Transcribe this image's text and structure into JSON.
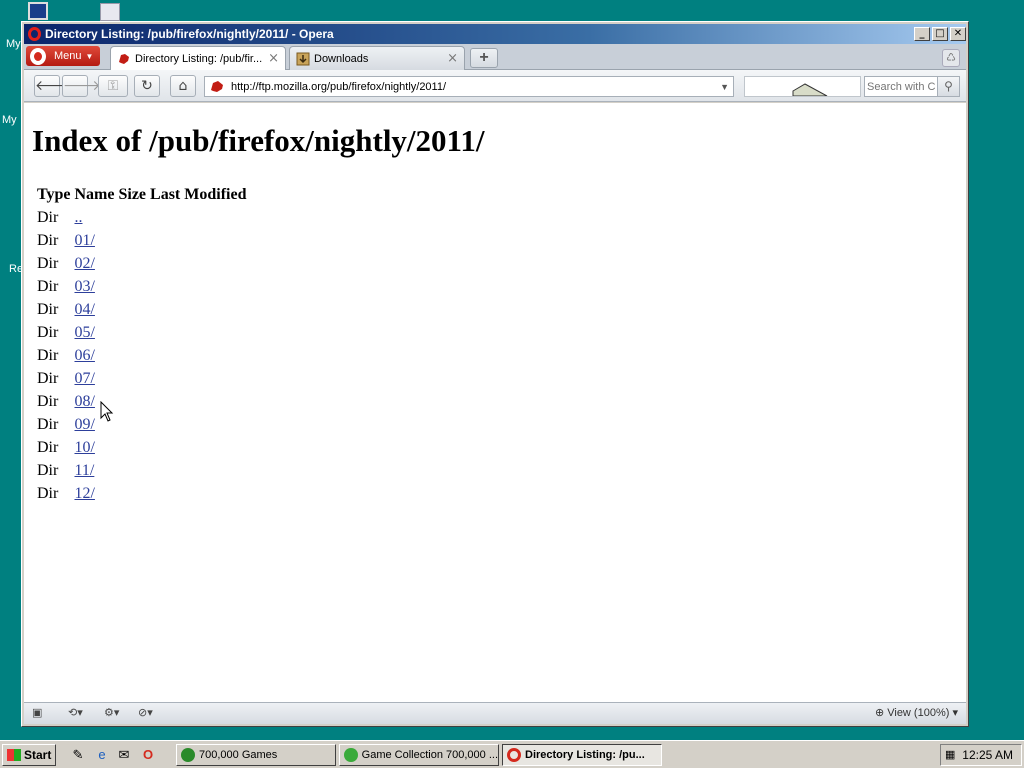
{
  "desktop": {
    "labels": [
      "My",
      "My",
      "Re"
    ]
  },
  "window": {
    "title": "Directory Listing: /pub/firefox/nightly/2011/ - Opera",
    "minimize_glyph": "_",
    "maximize_glyph": "□",
    "close_glyph": "✕"
  },
  "tabbar": {
    "menu_label": "Menu",
    "tabs": [
      {
        "label": "Directory Listing: /pub/fir...",
        "active": true
      },
      {
        "label": "Downloads",
        "active": false
      }
    ],
    "new_tab_glyph": "+"
  },
  "addressbar": {
    "url": "http://ftp.mozilla.org/pub/firefox/nightly/2011/",
    "search_placeholder": "Search with C"
  },
  "page": {
    "heading": "Index of /pub/firefox/nightly/2011/",
    "columns": [
      "Type",
      "Name",
      "Size",
      "Last Modified"
    ],
    "rows": [
      {
        "type": "Dir",
        "name": ".."
      },
      {
        "type": "Dir",
        "name": "01/"
      },
      {
        "type": "Dir",
        "name": "02/"
      },
      {
        "type": "Dir",
        "name": "03/"
      },
      {
        "type": "Dir",
        "name": "04/"
      },
      {
        "type": "Dir",
        "name": "05/"
      },
      {
        "type": "Dir",
        "name": "06/"
      },
      {
        "type": "Dir",
        "name": "07/"
      },
      {
        "type": "Dir",
        "name": "08/"
      },
      {
        "type": "Dir",
        "name": "09/"
      },
      {
        "type": "Dir",
        "name": "10/"
      },
      {
        "type": "Dir",
        "name": "11/"
      },
      {
        "type": "Dir",
        "name": "12/"
      }
    ]
  },
  "statusbar": {
    "zoom_label": "View (100%)"
  },
  "taskbar": {
    "start_label": "Start",
    "tasks": [
      {
        "label": "700,000 Games",
        "pressed": false
      },
      {
        "label": "Game Collection 700,000 ...",
        "pressed": false
      },
      {
        "label": "Directory Listing: /pu...",
        "pressed": true
      }
    ],
    "clock": "12:25 AM"
  },
  "colors": {
    "desktop": "#008080",
    "titlebar_start": "#0a246a",
    "opera_red": "#d42a1e",
    "link": "#2d3f9b"
  }
}
